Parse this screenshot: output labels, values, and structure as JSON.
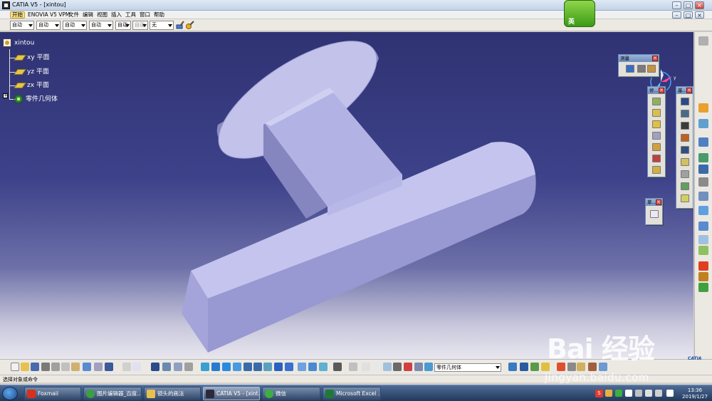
{
  "window": {
    "title": "CATIA V5 - [xintou]",
    "buttons": [
      "–",
      "□",
      "×"
    ],
    "inner_buttons": [
      "–",
      "□",
      "×"
    ]
  },
  "menu": {
    "items": [
      "开始",
      "ENOVIA V5 VPM",
      "文件",
      "编辑",
      "视图",
      "插入",
      "工具",
      "窗口",
      "帮助"
    ]
  },
  "select_toolbar": {
    "selects": [
      "自动",
      "自动",
      "自动",
      "自动",
      "自动",
      "自动",
      "无"
    ]
  },
  "tree": {
    "root": "xintou",
    "items": [
      "xy 平面",
      "yz 平面",
      "zx 平面",
      "零件几何体"
    ],
    "expander": "+"
  },
  "panels": {
    "measure_title": "测量",
    "panel2_title": "修...",
    "panel3_title": "基...",
    "panel4_title": "草..."
  },
  "logo": {
    "label": "英"
  },
  "compass": {
    "labels": [
      "z",
      "y",
      "x"
    ]
  },
  "bottom_toolbar": {
    "body_select": "零件几何体"
  },
  "status": {
    "text": "选择对象或命令"
  },
  "taskbar": {
    "tasks": [
      "Foxmail",
      "图片编辑器_百度...",
      "锁头的画法",
      "CATIA V5 - [xint...",
      "微信",
      "Microsoft Excel ..."
    ],
    "lang": "S",
    "time": "13:36",
    "date": "2019/1/27"
  },
  "watermark": {
    "logo": "Bai 经验",
    "url": "jingyan.baidu.com"
  },
  "catia_mark": "CATIA",
  "colors": {
    "part_top": "#b8b8e6",
    "part_side": "#8c8cc8",
    "part_dark": "#6e6eb0",
    "viewport_top": "#2f3272",
    "viewport_bottom": "#e8e7ef"
  }
}
